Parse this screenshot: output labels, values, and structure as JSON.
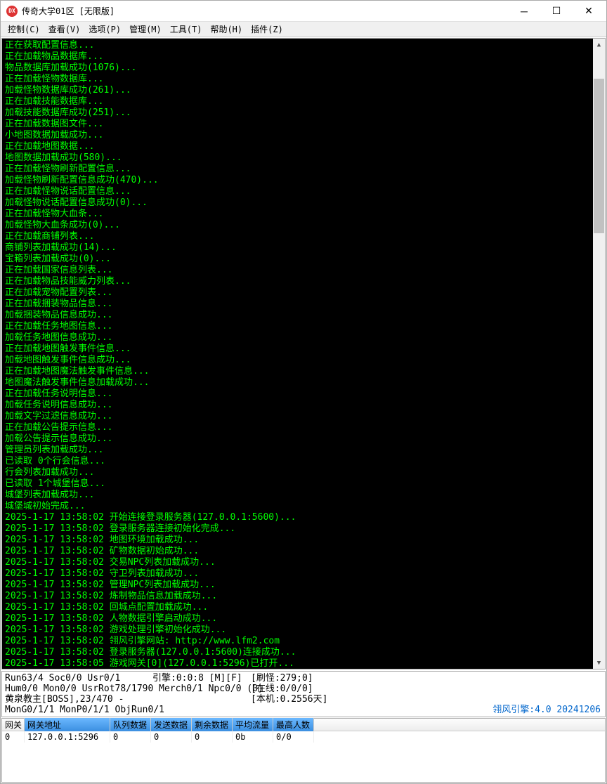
{
  "window": {
    "icon_text": "DX",
    "title": "传奇大学01区 [无限版]"
  },
  "menu": {
    "control": "控制(C)",
    "view": "查看(V)",
    "options": "选项(P)",
    "manage": "管理(M)",
    "tools": "工具(T)",
    "help": "帮助(H)",
    "plugins": "插件(Z)"
  },
  "console": {
    "lines": [
      "正在获取配置信息...",
      "正在加载物品数据库...",
      "物品数据库加载成功(1076)...",
      "正在加载怪物数据库...",
      "加载怪物数据库成功(261)...",
      "正在加载技能数据库...",
      "加载技能数据库成功(251)...",
      "正在加载数据图文件...",
      "小地图数据加载成功...",
      "正在加载地图数据...",
      "地图数据加载成功(580)...",
      "正在加载怪物刷新配置信息...",
      "加载怪物刷新配置信息成功(470)...",
      "正在加载怪物说话配置信息...",
      "加载怪物说话配置信息成功(0)...",
      "正在加载怪物大血条...",
      "加载怪物大血条成功(0)...",
      "正在加载商铺列表...",
      "商铺列表加载成功(14)...",
      "宝箱列表加载成功(0)...",
      "正在加载国家信息列表...",
      "正在加载物品技能威力列表...",
      "正在加载宠物配置列表...",
      "正在加载捆装物品信息...",
      "加载捆装物品信息成功...",
      "正在加载任务地图信息...",
      "加载任务地图信息成功...",
      "正在加载地图触发事件信息...",
      "加载地图触发事件信息成功...",
      "正在加载地图魔法触发事件信息...",
      "地图魔法触发事件信息加载成功...",
      "正在加载任务说明信息...",
      "加载任务说明信息成功...",
      "加载文字过滤信息成功...",
      "正在加载公告提示信息...",
      "加载公告提示信息成功...",
      "管理员列表加载成功...",
      "已读取 0个行会信息...",
      "行会列表加载成功...",
      "已读取 1个城堡信息...",
      "城堡列表加载成功...",
      "城堡城初始完成...",
      "2025-1-17 13:58:02 开始连接登录服务器(127.0.0.1:5600)...",
      "2025-1-17 13:58:02 登录服务器连接初始化完成...",
      "2025-1-17 13:58:02 地图环境加载成功...",
      "2025-1-17 13:58:02 矿物数据初始成功...",
      "2025-1-17 13:58:02 交易NPC列表加载成功...",
      "2025-1-17 13:58:02 守卫列表加载成功...",
      "2025-1-17 13:58:02 管理NPC列表加载成功...",
      "2025-1-17 13:58:02 炼制物品信息加载成功...",
      "2025-1-17 13:58:02 回城点配置加载成功...",
      "2025-1-17 13:58:02 人物数据引擎启动成功...",
      "2025-1-17 13:58:02 游戏处理引擎初始化成功...",
      "2025-1-17 13:58:02 翎风引擎网站: http://www.lfm2.com",
      "2025-1-17 13:58:02 登录服务器(127.0.0.1:5600)连接成功...",
      "2025-1-17 13:58:05 游戏网关[0](127.0.0.1:5296)已打开..."
    ]
  },
  "status": {
    "row1": {
      "c1": "Run63/4 Soc0/0 Usr0/1",
      "c2": "引擎:0:0:8 [M][F]",
      "c3": "[刷怪:279;0]"
    },
    "row2": {
      "c1": "Hum0/0 Mon0/0 UsrRot78/1790 Merch0/1 Npc0/0 (0)",
      "c3": "[在线:0/0/0]"
    },
    "row3": {
      "c1": "黄泉教主[BOSS],23/470 -",
      "c3": "[本机:0.2556天]"
    },
    "row4": {
      "c1": "MonG0/1/1 MonP0/1/1 ObjRun0/1"
    },
    "engine": "翎风引擎:4.0 20241206"
  },
  "table": {
    "headers": [
      "网关",
      "网关地址",
      "队列数据",
      "发送数据",
      "剩余数据",
      "平均流量",
      "最高人数"
    ],
    "row": {
      "gateway": "0",
      "address": "127.0.0.1:5296",
      "queue": "0",
      "send": "0",
      "remain": "0",
      "avg": "0b",
      "max": "0/0"
    }
  }
}
